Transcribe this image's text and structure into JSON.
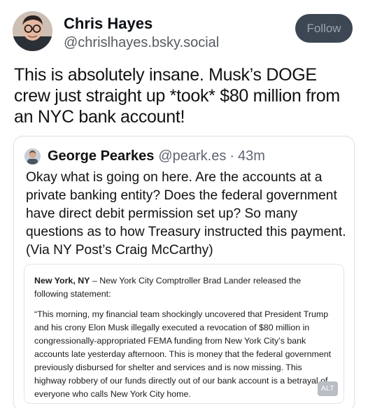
{
  "author": {
    "display_name": "Chris Hayes",
    "handle": "@chrislhayes.bsky.social",
    "avatar_icon": "person-avatar-icon"
  },
  "follow_label": "Follow",
  "post_text": "This is absolutely insane. Musk’s DOGE crew just straight up *took* $80 million from an NYC bank account!",
  "quote": {
    "display_name": "George Pearkes",
    "handle": "@peark.es",
    "separator": "·",
    "time": "43m",
    "avatar_icon": "person-avatar-icon",
    "text": "Okay what is going on here. Are the accounts at a private banking entity? Does the federal government have direct debit permission set up? So many questions as to how Treasury instructed this payment. (Via NY Post’s Craig McCarthy)",
    "embed": {
      "location": "New York, NY",
      "lead": " – New York City Comptroller Brad Lander released the following statement:",
      "quote_body": "“This morning, my financial team shockingly uncovered that President Trump and his crony Elon Musk illegally executed a revocation of $80 million in congressionally-appropriated FEMA funding from New York City’s bank accounts late yesterday afternoon. This is money that the federal government previously disbursed for shelter and services and is now missing. This highway robbery of our funds directly out of our bank account is a betrayal of everyone who calls New York City home.",
      "alt_label": "ALT"
    }
  },
  "colors": {
    "follow_bg": "#3d4754",
    "follow_text": "#9aa3ae",
    "handle_gray": "#555b63",
    "card_border": "#dcdfe3"
  }
}
